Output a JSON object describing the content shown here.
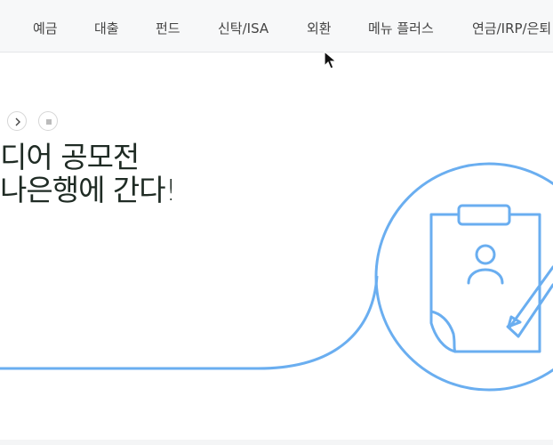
{
  "nav": {
    "items": [
      {
        "label": "예금"
      },
      {
        "label": "대출"
      },
      {
        "label": "펀드"
      },
      {
        "label": "신탁/ISA"
      },
      {
        "label": "외환"
      },
      {
        "label": "메뉴 플러스"
      },
      {
        "label": "연금/IRP/은퇴"
      }
    ]
  },
  "banner": {
    "headline_line1": "디어 공모전",
    "headline_line2": "나은행에 간다!",
    "next_icon": "chevron-right-icon",
    "stop_icon": "stop-icon",
    "illustration_icon": "clipboard-person-pencil-icon"
  },
  "colors": {
    "accent_blue": "#6aaef0",
    "headline": "#1f2b24",
    "nav_bg": "#f7f8f9"
  }
}
